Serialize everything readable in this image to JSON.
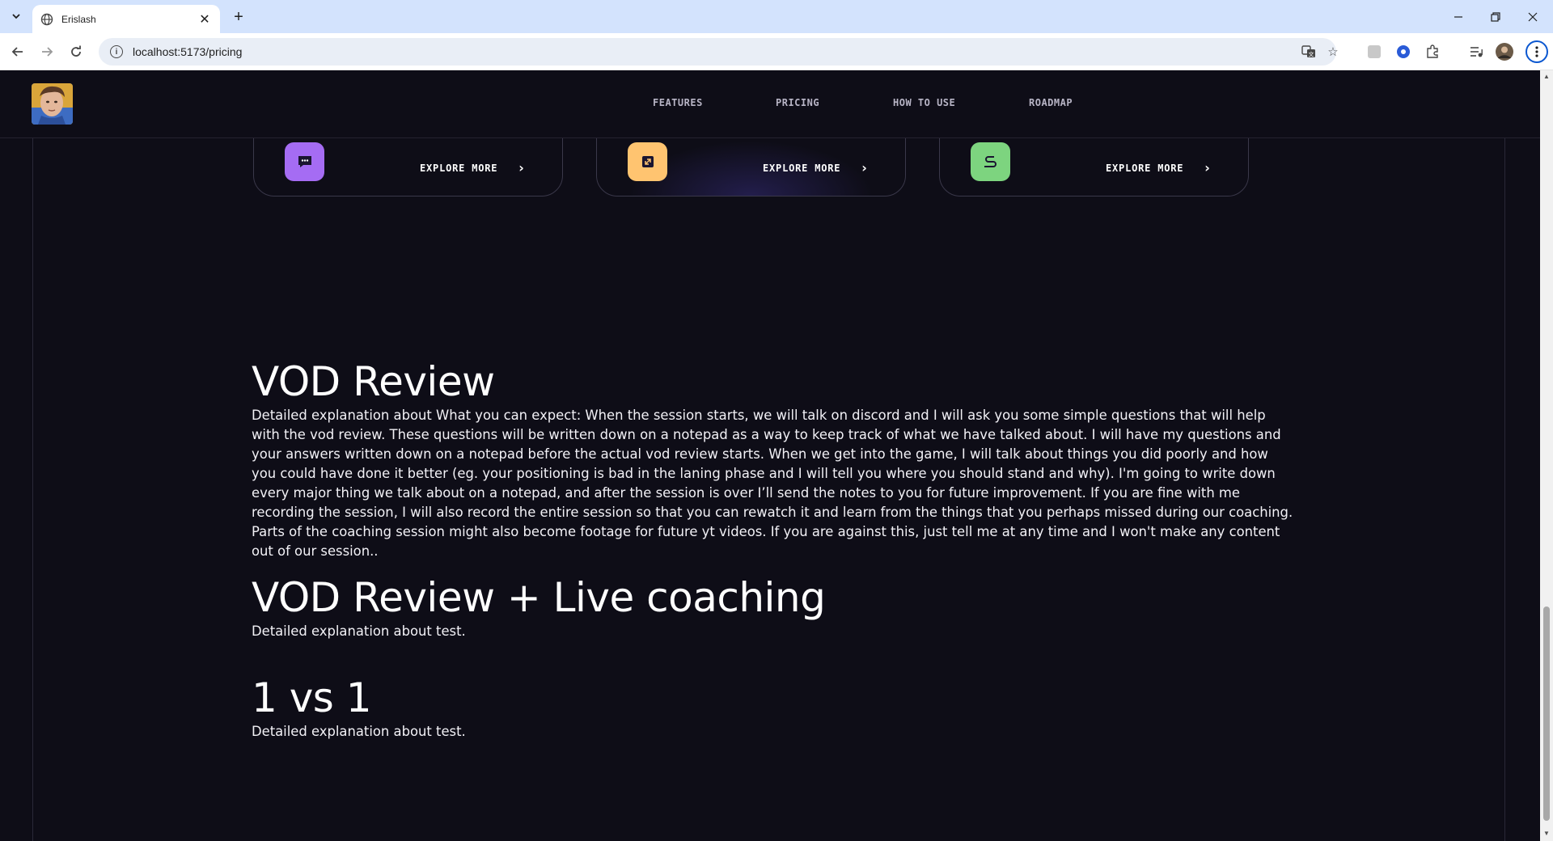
{
  "browser": {
    "tab_title": "Erislash",
    "url": "localhost:5173/pricing"
  },
  "icons": {
    "tab_search": "chevron-down-icon",
    "favicon": "globe-icon",
    "tab_close": "close-icon",
    "new_tab": "plus-icon",
    "back": "back-arrow-icon",
    "forward": "forward-arrow-icon",
    "reload": "reload-icon",
    "site_info": "info-icon",
    "translate": "translate-icon",
    "bookmark": "star-icon",
    "extensions": "puzzle-icon",
    "media": "media-control-icon",
    "profile": "profile-avatar",
    "menu": "kebab-menu-icon"
  },
  "nav": {
    "features": "FEATURES",
    "pricing": "PRICING",
    "how_to_use": "HOW TO USE",
    "roadmap": "ROADMAP"
  },
  "cards": [
    {
      "link_label": "EXPLORE MORE",
      "icon": "chat-icon",
      "icon_color": "#a56cf3"
    },
    {
      "link_label": "EXPLORE MORE",
      "icon": "expand-icon",
      "icon_color": "#ffc470"
    },
    {
      "link_label": "EXPLORE MORE",
      "icon": "route-icon",
      "icon_color": "#7dd47f"
    }
  ],
  "sections": [
    {
      "title": "VOD Review",
      "description": "Detailed explanation about What you can expect: When the session starts, we will talk on discord and I will ask you some simple questions that will help with the vod review. These questions will be written down on a notepad as a way to keep track of what we have talked about. I will have my questions and your answers written down on a notepad before the actual vod review starts. When we get into the game, I will talk about things you did poorly and how you could have done it better (eg. your positioning is bad in the laning phase and I will tell you where you should stand and why). I'm going to write down every major thing we talk about on a notepad, and after the session is over I’ll send the notes to you for future improvement. If you are fine with me recording the session, I will also record the entire session so that you can rewatch it and learn from the things that you perhaps missed during our coaching. Parts of the coaching session might also become footage for future yt videos. If you are against this, just tell me at any time and I won't make any content out of our session.."
    },
    {
      "title": "VOD Review + Live coaching",
      "description": "Detailed explanation about test."
    },
    {
      "title": "1 vs 1",
      "description": "Detailed explanation about test."
    }
  ],
  "colors": {
    "page_bg": "#0e0d17",
    "chrome_tabstrip": "#d3e3fd",
    "card_border": "#3a384a"
  }
}
